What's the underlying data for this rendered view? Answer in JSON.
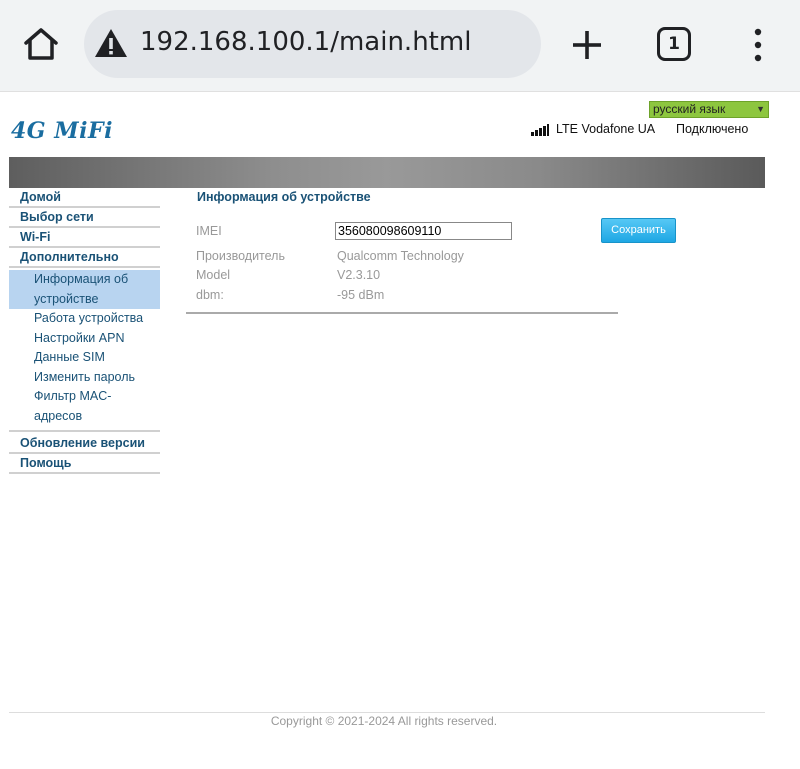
{
  "browser": {
    "url": "192.168.100.1/main.html",
    "tab_count": "1",
    "icons": [
      "home-icon",
      "warning-icon",
      "plus-icon",
      "tabs-icon",
      "more-vert-icon"
    ]
  },
  "header": {
    "language": "русский язык",
    "logo": "4G MiFi",
    "network": "LTE Vodafone UA",
    "status": "Подключено"
  },
  "sidebar": {
    "items": [
      {
        "label": "Домой"
      },
      {
        "label": "Выбор сети"
      },
      {
        "label": "Wi-Fi"
      },
      {
        "label": "Дополнительно"
      }
    ],
    "subitems": [
      {
        "label": "Информация об устройстве",
        "line1": "Информация об",
        "line2": "устройстве",
        "active": true
      },
      {
        "label": "Работа устройства"
      },
      {
        "label": "Настройки APN"
      },
      {
        "label": "Данные SIM"
      },
      {
        "label": "Изменить пароль"
      },
      {
        "label": "Фильтр MAC-адресов",
        "line1": "Фильтр MAC-",
        "line2": "адресов"
      }
    ],
    "bottom_items": [
      {
        "label": "Обновление версии"
      },
      {
        "label": "Помощь"
      }
    ]
  },
  "content": {
    "title": "Информация об устройстве",
    "imei_label": "IMEI",
    "imei_value": "356080098609110",
    "save_label": "Сохранить",
    "manufacturer_label": "Производитель",
    "manufacturer_value": "Qualcomm Technology",
    "model_label": "Model",
    "model_value": "V2.3.10",
    "dbm_label": "dbm:",
    "dbm_value": "-95 dBm"
  },
  "footer": {
    "copyright": "Copyright © 2021-2024 All rights reserved."
  },
  "colors": {
    "accent": "#1a5276",
    "language_bg": "#8dc63f",
    "save_button": "#1ea7e4",
    "active_nav": "#b8d4f0"
  }
}
